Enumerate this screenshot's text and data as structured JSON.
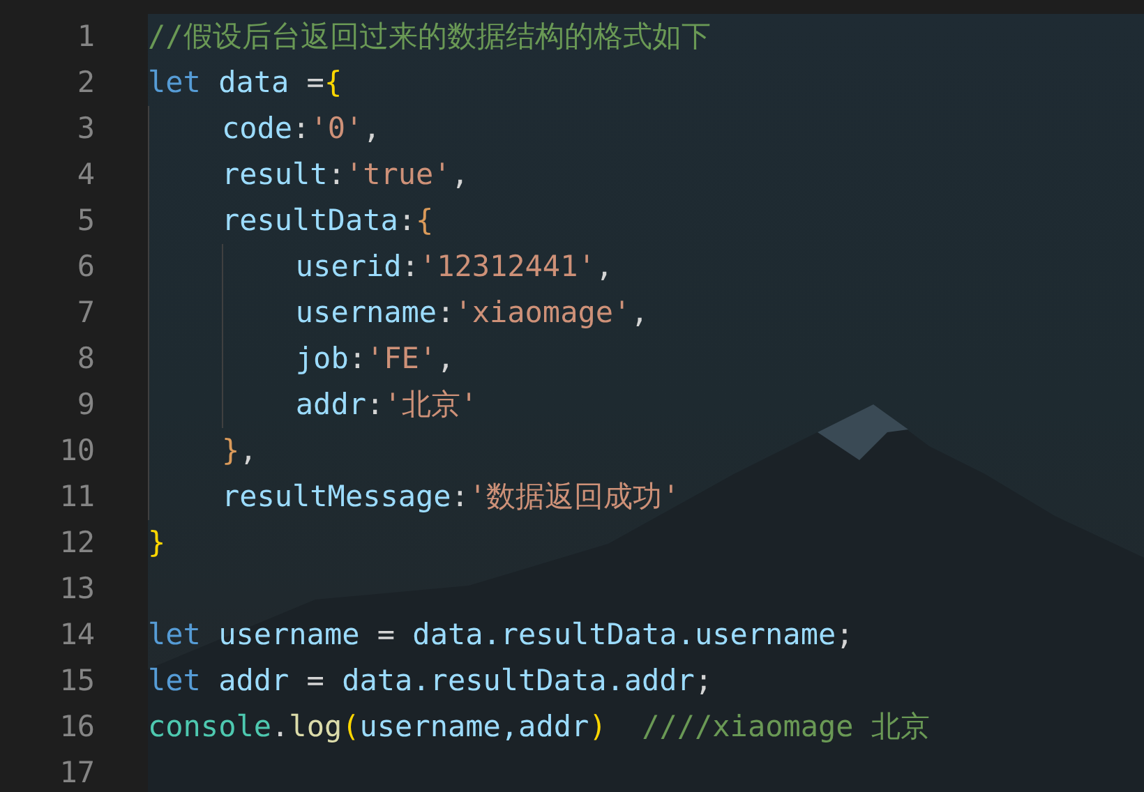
{
  "editor": {
    "lines": [
      {
        "number": "1",
        "tokens": [
          {
            "text": "//假设后台返回过来的数据结构的格式如下",
            "kind": "comment"
          }
        ]
      },
      {
        "number": "2",
        "tokens": [
          {
            "text": "let",
            "kind": "keyword"
          },
          {
            "text": " data",
            "kind": "variable"
          },
          {
            "text": " =",
            "kind": "plain"
          },
          {
            "text": "{",
            "kind": "bracket1"
          }
        ],
        "children": [
          {
            "number": "3",
            "tokens": [
              {
                "text": "code",
                "kind": "variable"
              },
              {
                "text": ":",
                "kind": "plain"
              },
              {
                "text": "'0'",
                "kind": "string"
              },
              {
                "text": ",",
                "kind": "plain"
              }
            ]
          },
          {
            "number": "4",
            "tokens": [
              {
                "text": "result",
                "kind": "variable"
              },
              {
                "text": ":",
                "kind": "plain"
              },
              {
                "text": "'true'",
                "kind": "string"
              },
              {
                "text": ",",
                "kind": "plain"
              }
            ]
          },
          {
            "number": "5",
            "tokens": [
              {
                "text": "resultData",
                "kind": "variable"
              },
              {
                "text": ":",
                "kind": "plain"
              },
              {
                "text": "{",
                "kind": "bracket2"
              }
            ],
            "children": [
              {
                "number": "6",
                "tokens": [
                  {
                    "text": "userid",
                    "kind": "variable"
                  },
                  {
                    "text": ":",
                    "kind": "plain"
                  },
                  {
                    "text": "'12312441'",
                    "kind": "string"
                  },
                  {
                    "text": ",",
                    "kind": "plain"
                  }
                ]
              },
              {
                "number": "7",
                "tokens": [
                  {
                    "text": "username",
                    "kind": "variable"
                  },
                  {
                    "text": ":",
                    "kind": "plain"
                  },
                  {
                    "text": "'xiaomage'",
                    "kind": "string"
                  },
                  {
                    "text": ",",
                    "kind": "plain"
                  }
                ]
              },
              {
                "number": "8",
                "tokens": [
                  {
                    "text": "job",
                    "kind": "variable"
                  },
                  {
                    "text": ":",
                    "kind": "plain"
                  },
                  {
                    "text": "'FE'",
                    "kind": "string"
                  },
                  {
                    "text": ",",
                    "kind": "plain"
                  }
                ]
              },
              {
                "number": "9",
                "tokens": [
                  {
                    "text": "addr",
                    "kind": "variable"
                  },
                  {
                    "text": ":",
                    "kind": "plain"
                  },
                  {
                    "text": "'北京'",
                    "kind": "string"
                  }
                ]
              }
            ]
          },
          {
            "number": "10",
            "tokens": [
              {
                "text": "}",
                "kind": "bracket2"
              },
              {
                "text": ",",
                "kind": "plain"
              }
            ]
          },
          {
            "number": "11",
            "tokens": [
              {
                "text": "resultMessage",
                "kind": "variable"
              },
              {
                "text": ":",
                "kind": "plain"
              },
              {
                "text": "'数据返回成功'",
                "kind": "string"
              }
            ]
          }
        ]
      },
      {
        "number": "12",
        "tokens": [
          {
            "text": "}",
            "kind": "bracket1"
          }
        ]
      },
      {
        "number": "13"
      },
      {
        "number": "14",
        "tokens": [
          {
            "text": "let",
            "kind": "keyword"
          },
          {
            "text": " username",
            "kind": "variable"
          },
          {
            "text": " = ",
            "kind": "plain"
          },
          {
            "text": "data.resultData.username",
            "kind": "variable"
          },
          {
            "text": ";",
            "kind": "plain"
          }
        ]
      },
      {
        "number": "15",
        "tokens": [
          {
            "text": "let",
            "kind": "keyword"
          },
          {
            "text": " addr",
            "kind": "variable"
          },
          {
            "text": " = ",
            "kind": "plain"
          },
          {
            "text": "data.resultData.addr",
            "kind": "variable"
          },
          {
            "text": ";",
            "kind": "plain"
          }
        ]
      },
      {
        "number": "16",
        "tokens": [
          {
            "text": "console",
            "kind": "class"
          },
          {
            "text": ".",
            "kind": "plain"
          },
          {
            "text": "log",
            "kind": "function"
          },
          {
            "text": "(",
            "kind": "bracket1"
          },
          {
            "text": "username,addr",
            "kind": "variable"
          },
          {
            "text": ")",
            "kind": "bracket1"
          },
          {
            "text": "  ////xiaomage 北京",
            "kind": "comment"
          }
        ]
      },
      {
        "number": "17"
      }
    ]
  }
}
